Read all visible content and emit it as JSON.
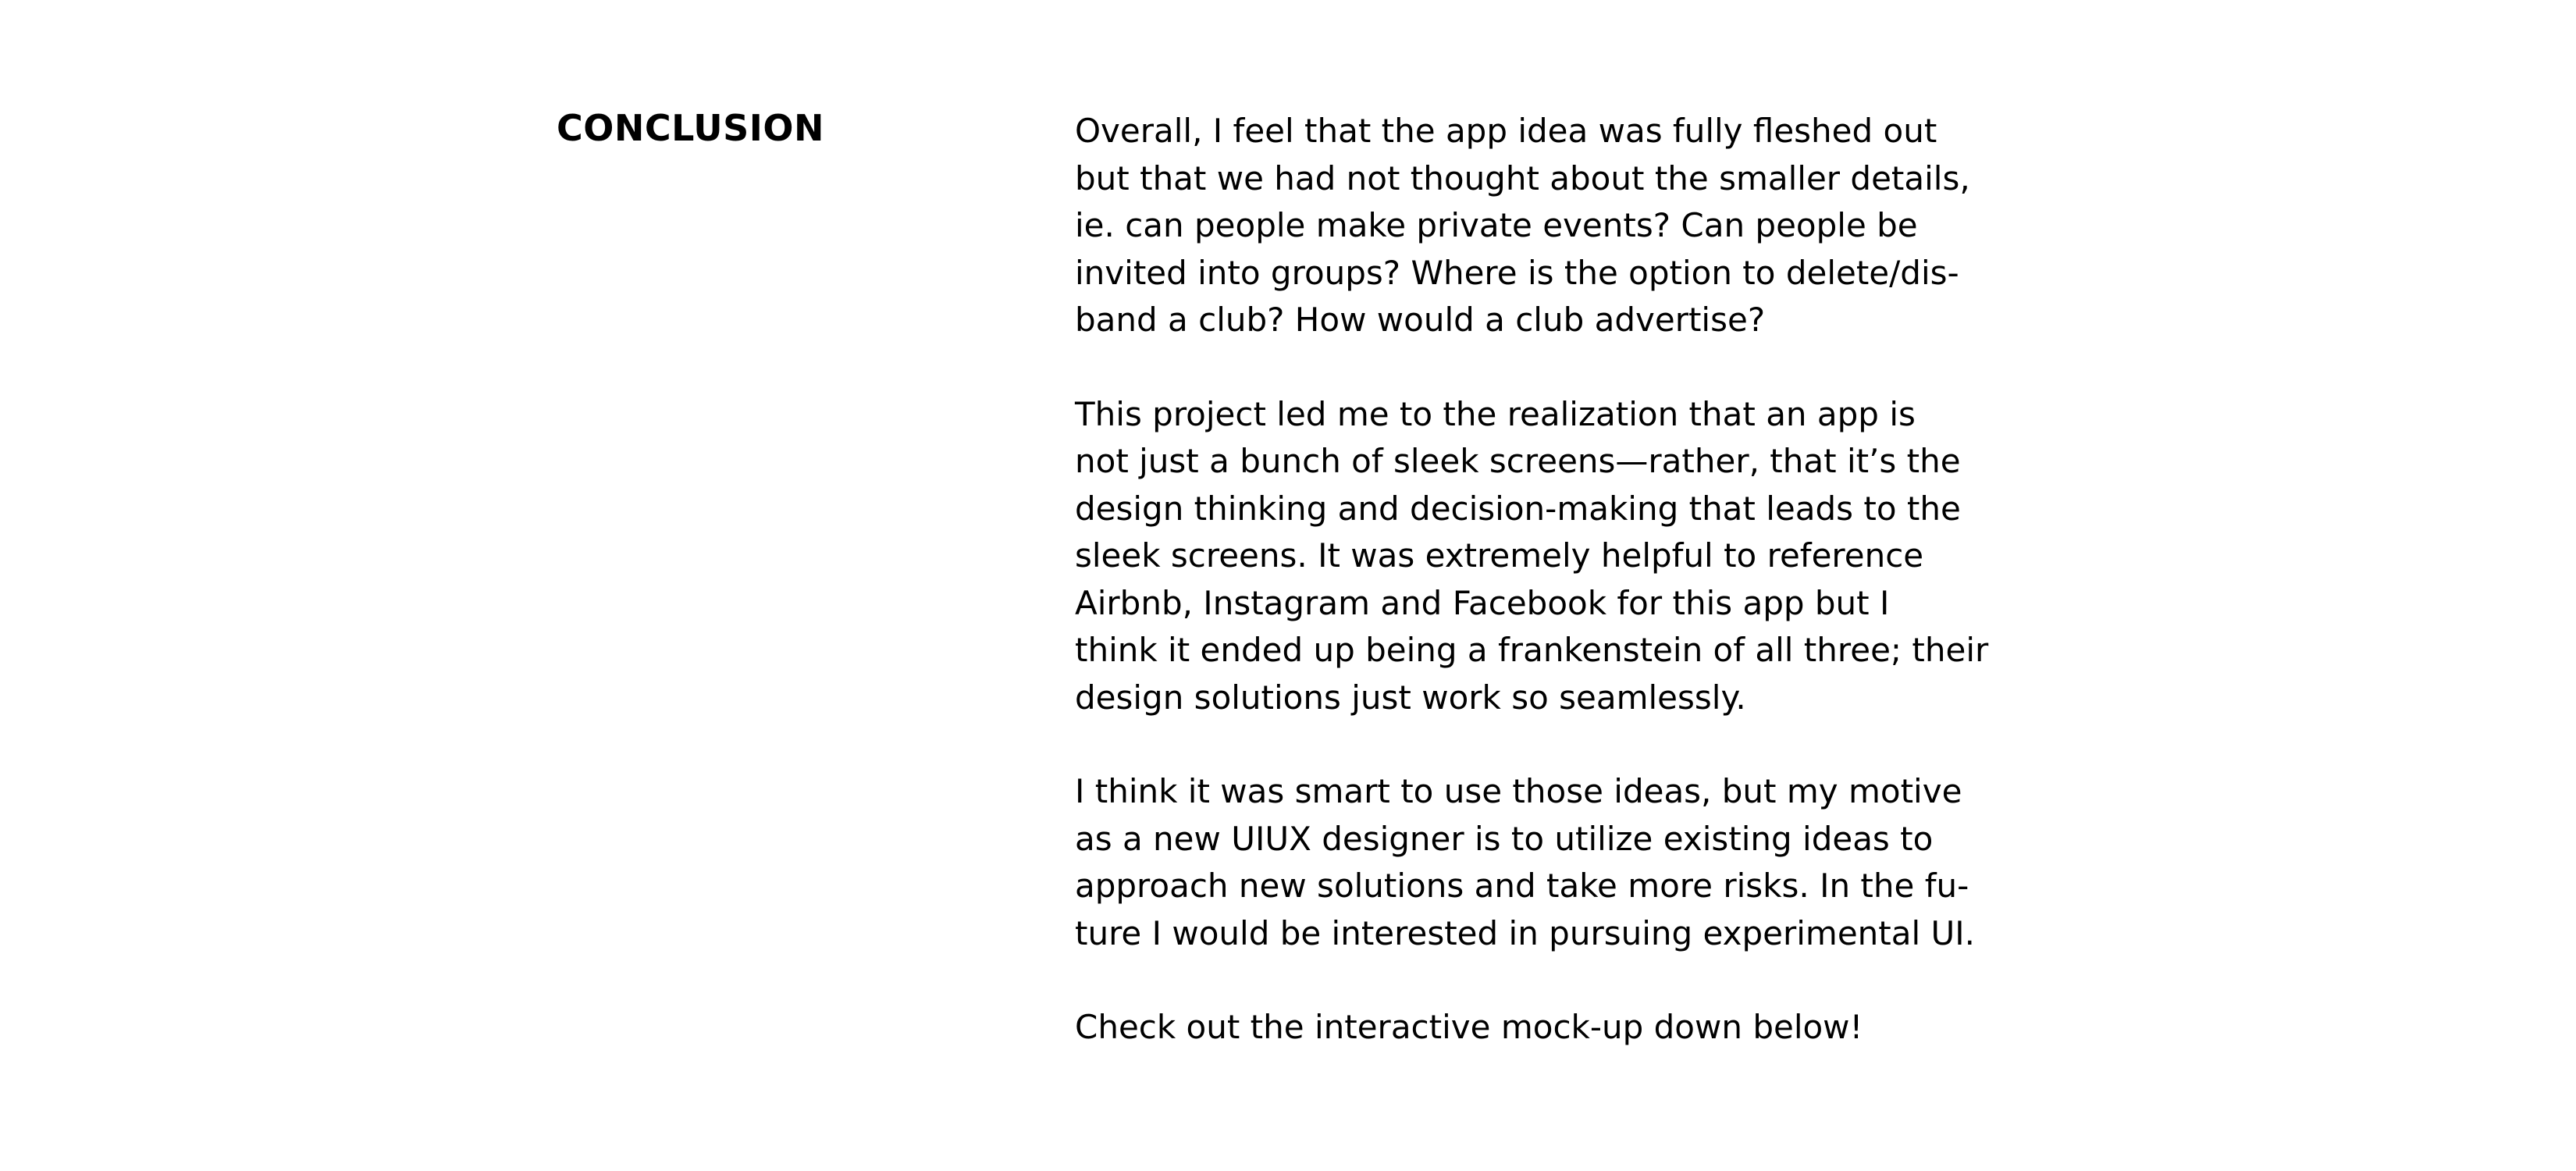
{
  "section": {
    "heading": "CONCLUSION",
    "paragraphs": [
      {
        "lines": [
          "Overall, I feel that the app idea was fully fleshed out",
          "but that we had not thought about the smaller details,",
          "ie. can people make private events? Can people be",
          "invited into groups? Where is the option to delete/dis-",
          "band a club? How would a club advertise?"
        ]
      },
      {
        "lines": [
          "This project led me to the realization that an app is",
          "not just a bunch of sleek screens—rather, that it’s the",
          "design thinking and decision-making that leads to the",
          "sleek screens. It was extremely helpful to reference",
          "Airbnb, Instagram and Facebook for this app but I",
          "think it ended up being a frankenstein of all three; their",
          "design solutions just work so seamlessly."
        ]
      },
      {
        "lines": [
          "I think it was smart to use those ideas, but my motive",
          "as a new UIUX designer is to utilize existing ideas to",
          "approach new solutions and take more risks. In the fu-",
          "ture I would be interested in pursuing experimental UI."
        ]
      },
      {
        "lines": [
          "Check out the interactive mock-up down below!"
        ]
      }
    ]
  }
}
